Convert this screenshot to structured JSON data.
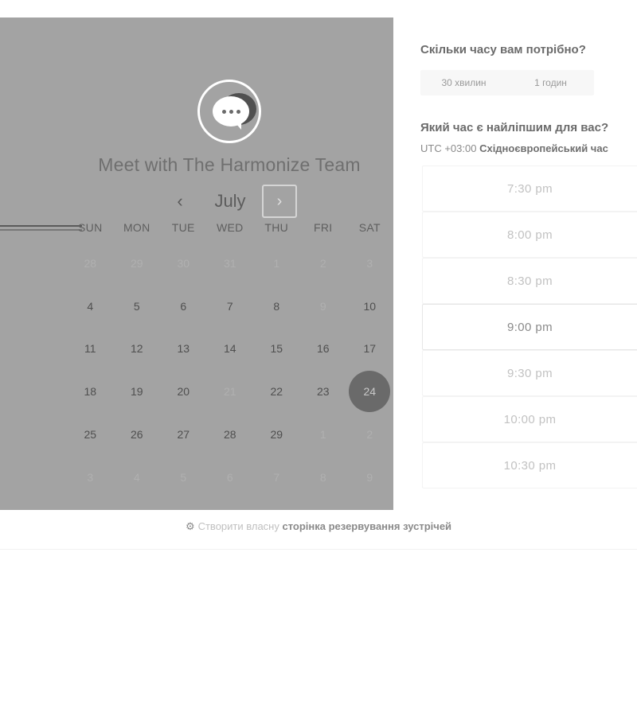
{
  "calendar": {
    "title": "Meet with The Harmonize Team",
    "month": "July",
    "prev_symbol": "‹",
    "next_symbol": "›",
    "weekdays": [
      "SUN",
      "MON",
      "TUE",
      "WED",
      "THU",
      "FRI",
      "SAT"
    ],
    "weeks": [
      [
        "28",
        "29",
        "30",
        "31",
        "1",
        "2",
        "3"
      ],
      [
        "4",
        "5",
        "6",
        "7",
        "8",
        "9",
        "10"
      ],
      [
        "11",
        "12",
        "13",
        "14",
        "15",
        "16",
        "17"
      ],
      [
        "18",
        "19",
        "20",
        "21",
        "22",
        "23",
        "24"
      ],
      [
        "25",
        "26",
        "27",
        "28",
        "29",
        "1",
        "2"
      ],
      [
        "3",
        "4",
        "5",
        "6",
        "7",
        "8",
        "9"
      ]
    ],
    "selected_day": "24"
  },
  "booking": {
    "duration_question": "Скільки часу вам потрібно?",
    "durations": [
      "30 хвилин",
      "1 годин"
    ],
    "time_question": "Який час є найліпшим для вас?",
    "timezone_offset": "UTC +03:00",
    "timezone_name": "Східноєвропейський час",
    "time_slots": [
      "7:30 pm",
      "8:00 pm",
      "8:30 pm",
      "9:00 pm",
      "9:30 pm",
      "10:00 pm",
      "10:30 pm"
    ]
  },
  "footer": {
    "icon": "hubspot-sprocket-icon",
    "icon_glyph": "⚙",
    "prefix": "Створити власну",
    "link_text": "сторінка резервування зустрічей"
  },
  "colors": {
    "overlay": "#a3a3a3",
    "selected_day": "#6a6a6a"
  }
}
